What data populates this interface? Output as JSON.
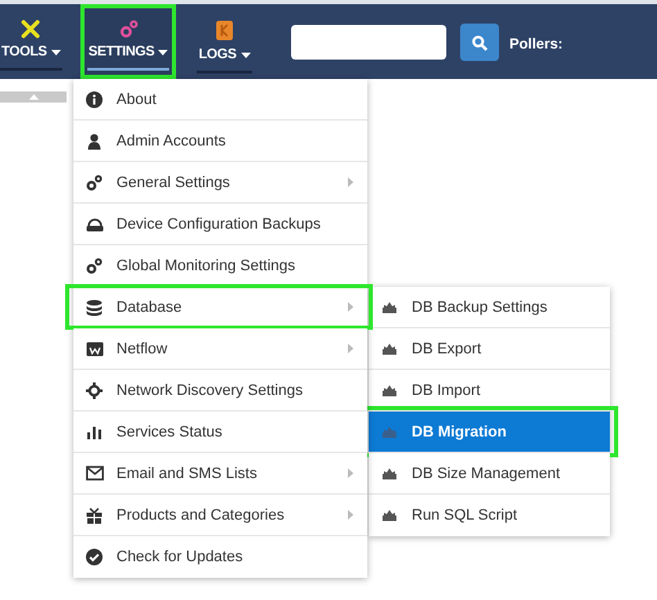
{
  "navbar": {
    "items": [
      {
        "label": "TOOLS",
        "selected": false,
        "highlighted": false
      },
      {
        "label": "SETTINGS",
        "selected": true,
        "highlighted": true
      },
      {
        "label": "LOGS",
        "selected": false,
        "highlighted": false
      }
    ],
    "pollers_label": "Pollers:"
  },
  "settings_menu": {
    "items": [
      {
        "label": "About",
        "has_submenu": false,
        "highlighted": false
      },
      {
        "label": "Admin Accounts",
        "has_submenu": false,
        "highlighted": false
      },
      {
        "label": "General Settings",
        "has_submenu": true,
        "highlighted": false
      },
      {
        "label": "Device Configuration Backups",
        "has_submenu": false,
        "highlighted": false
      },
      {
        "label": "Global Monitoring Settings",
        "has_submenu": false,
        "highlighted": false
      },
      {
        "label": "Database",
        "has_submenu": true,
        "highlighted": true
      },
      {
        "label": "Netflow",
        "has_submenu": true,
        "highlighted": false
      },
      {
        "label": "Network Discovery Settings",
        "has_submenu": false,
        "highlighted": false
      },
      {
        "label": "Services Status",
        "has_submenu": false,
        "highlighted": false
      },
      {
        "label": "Email and SMS Lists",
        "has_submenu": true,
        "highlighted": false
      },
      {
        "label": "Products and Categories",
        "has_submenu": true,
        "highlighted": false
      },
      {
        "label": "Check for Updates",
        "has_submenu": false,
        "highlighted": false
      }
    ]
  },
  "database_submenu": {
    "items": [
      {
        "label": "DB Backup Settings",
        "selected": false,
        "highlighted": false
      },
      {
        "label": "DB Export",
        "selected": false,
        "highlighted": false
      },
      {
        "label": "DB Import",
        "selected": false,
        "highlighted": false
      },
      {
        "label": "DB Migration",
        "selected": true,
        "highlighted": true
      },
      {
        "label": "DB Size Management",
        "selected": false,
        "highlighted": false
      },
      {
        "label": "Run SQL Script",
        "selected": false,
        "highlighted": false
      }
    ]
  }
}
